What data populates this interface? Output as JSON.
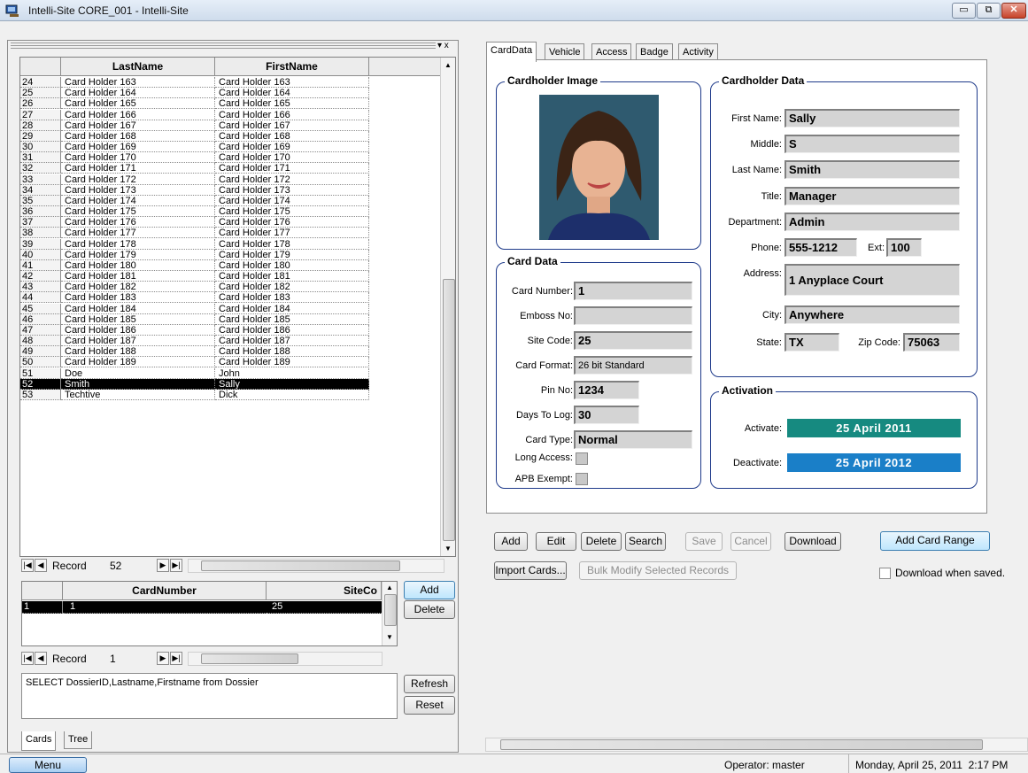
{
  "window": {
    "title": "Intelli-Site CORE_001 - Intelli-Site",
    "min_glyph": "▭",
    "restore_glyph": "⧉",
    "close_glyph": "✕"
  },
  "dock": {
    "controls": "▾ x"
  },
  "grid1": {
    "headers": [
      "LastName",
      "FirstName"
    ],
    "rows": [
      {
        "n": "24",
        "last": "Card Holder 163",
        "first": "Card Holder 163"
      },
      {
        "n": "25",
        "last": "Card Holder 164",
        "first": "Card Holder 164"
      },
      {
        "n": "26",
        "last": "Card Holder 165",
        "first": "Card Holder 165"
      },
      {
        "n": "27",
        "last": "Card Holder 166",
        "first": "Card Holder 166"
      },
      {
        "n": "28",
        "last": "Card Holder 167",
        "first": "Card Holder 167"
      },
      {
        "n": "29",
        "last": "Card Holder 168",
        "first": "Card Holder 168"
      },
      {
        "n": "30",
        "last": "Card Holder 169",
        "first": "Card Holder 169"
      },
      {
        "n": "31",
        "last": "Card Holder 170",
        "first": "Card Holder 170"
      },
      {
        "n": "32",
        "last": "Card Holder 171",
        "first": "Card Holder 171"
      },
      {
        "n": "33",
        "last": "Card Holder 172",
        "first": "Card Holder 172"
      },
      {
        "n": "34",
        "last": "Card Holder 173",
        "first": "Card Holder 173"
      },
      {
        "n": "35",
        "last": "Card Holder 174",
        "first": "Card Holder 174"
      },
      {
        "n": "36",
        "last": "Card Holder 175",
        "first": "Card Holder 175"
      },
      {
        "n": "37",
        "last": "Card Holder 176",
        "first": "Card Holder 176"
      },
      {
        "n": "38",
        "last": "Card Holder 177",
        "first": "Card Holder 177"
      },
      {
        "n": "39",
        "last": "Card Holder 178",
        "first": "Card Holder 178"
      },
      {
        "n": "40",
        "last": "Card Holder 179",
        "first": "Card Holder 179"
      },
      {
        "n": "41",
        "last": "Card Holder 180",
        "first": "Card Holder 180"
      },
      {
        "n": "42",
        "last": "Card Holder 181",
        "first": "Card Holder 181"
      },
      {
        "n": "43",
        "last": "Card Holder 182",
        "first": "Card Holder 182"
      },
      {
        "n": "44",
        "last": "Card Holder 183",
        "first": "Card Holder 183"
      },
      {
        "n": "45",
        "last": "Card Holder 184",
        "first": "Card Holder 184"
      },
      {
        "n": "46",
        "last": "Card Holder 185",
        "first": "Card Holder 185"
      },
      {
        "n": "47",
        "last": "Card Holder 186",
        "first": "Card Holder 186"
      },
      {
        "n": "48",
        "last": "Card Holder 187",
        "first": "Card Holder 187"
      },
      {
        "n": "49",
        "last": "Card Holder 188",
        "first": "Card Holder 188"
      },
      {
        "n": "50",
        "last": "Card Holder 189",
        "first": "Card Holder 189"
      },
      {
        "n": "51",
        "last": "Doe",
        "first": "John"
      },
      {
        "n": "52",
        "last": "Smith",
        "first": "Sally",
        "selected": true
      },
      {
        "n": "53",
        "last": "Techtive",
        "first": "Dick"
      }
    ],
    "nav": {
      "record_label": "Record",
      "record_value": "52"
    }
  },
  "grid2": {
    "headers": [
      "CardNumber",
      "SiteCo"
    ],
    "rows": [
      {
        "n": "1",
        "card": "1",
        "site": "25"
      }
    ],
    "nav": {
      "record_label": "Record",
      "record_value": "1"
    },
    "add_label": "Add",
    "delete_label": "Delete"
  },
  "sql": {
    "query": "SELECT DossierID,Lastname,Firstname from Dossier",
    "refresh_label": "Refresh",
    "reset_label": "Reset"
  },
  "bottom_tabs": [
    "Cards",
    "Tree"
  ],
  "tabs": [
    "CardData",
    "Vehicle",
    "Access",
    "Badge",
    "Activity"
  ],
  "cardholder_image": {
    "title": "Cardholder Image"
  },
  "cardholder": {
    "title": "Cardholder Data",
    "first_name": {
      "label": "First Name:",
      "value": "Sally"
    },
    "middle": {
      "label": "Middle:",
      "value": "S"
    },
    "last_name": {
      "label": "Last Name:",
      "value": "Smith"
    },
    "title_field": {
      "label": "Title:",
      "value": "Manager"
    },
    "department": {
      "label": "Department:",
      "value": "Admin"
    },
    "phone": {
      "label": "Phone:",
      "value": "555-1212"
    },
    "ext": {
      "label": "Ext:",
      "value": "100"
    },
    "address": {
      "label": "Address:",
      "value": "1 Anyplace Court"
    },
    "city": {
      "label": "City:",
      "value": "Anywhere"
    },
    "state": {
      "label": "State:",
      "value": "TX"
    },
    "zip": {
      "label": "Zip Code:",
      "value": "75063"
    }
  },
  "card_data": {
    "title": "Card Data",
    "card_number": {
      "label": "Card Number:",
      "value": "1"
    },
    "emboss_no": {
      "label": "Emboss No:",
      "value": ""
    },
    "site_code": {
      "label": "Site Code:",
      "value": "25"
    },
    "card_format": {
      "label": "Card Format:",
      "value": "26 bit Standard"
    },
    "pin_no": {
      "label": "Pin No:",
      "value": "1234"
    },
    "days_to_log": {
      "label": "Days To Log:",
      "value": "30"
    },
    "card_type": {
      "label": "Card Type:",
      "value": "Normal"
    },
    "long_access": {
      "label": "Long Access:"
    },
    "apb_exempt": {
      "label": "APB Exempt:"
    }
  },
  "activation": {
    "title": "Activation",
    "activate": {
      "label": "Activate:",
      "value": "25  April  2011",
      "color": "#168a80"
    },
    "deactivate": {
      "label": "Deactivate:",
      "value": "25  April  2012",
      "color": "#1a7fc8"
    }
  },
  "actions": {
    "add": "Add",
    "edit": "Edit",
    "delete": "Delete",
    "search": "Search",
    "save": "Save",
    "cancel": "Cancel",
    "download": "Download",
    "add_card_range": "Add Card Range",
    "import_cards": "Import Cards...",
    "bulk_modify": "Bulk Modify Selected Records",
    "download_when_saved": "Download when saved."
  },
  "status": {
    "menu": "Menu",
    "operator": "Operator: master",
    "datetime": "Monday, April 25, 2011  2:17 PM"
  }
}
